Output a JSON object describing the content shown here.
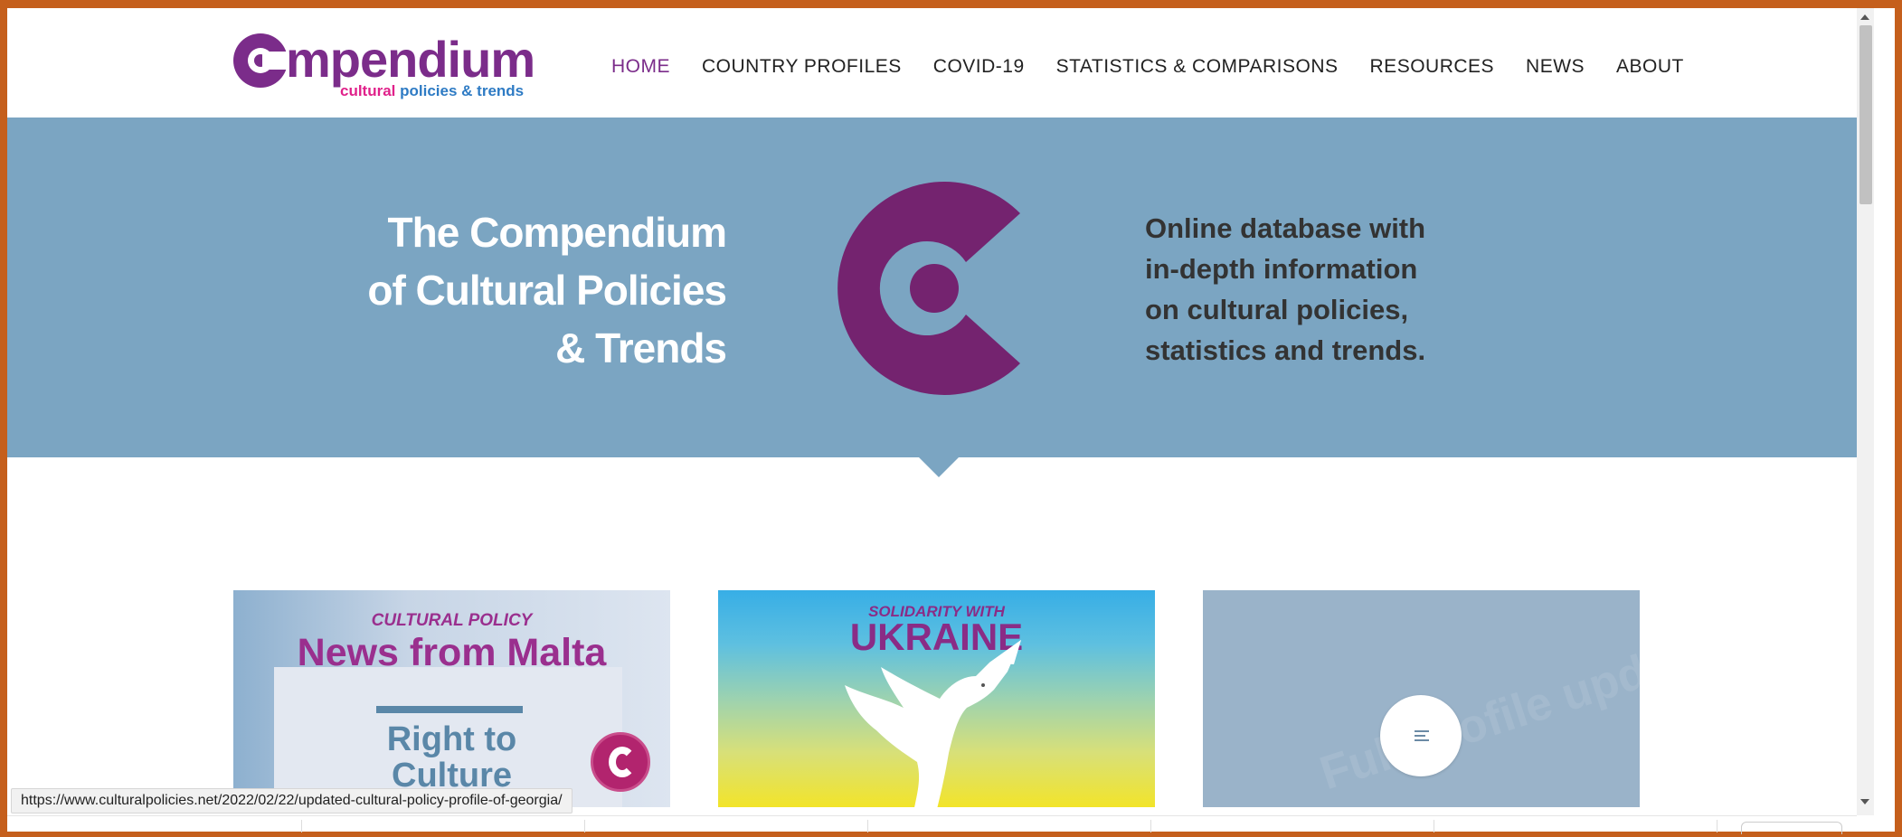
{
  "logo": {
    "wordmark": "mpendium",
    "tagline_part1": "cultural",
    "tagline_part2": "policies & trends"
  },
  "nav": {
    "items": [
      {
        "label": "HOME",
        "active": true
      },
      {
        "label": "COUNTRY PROFILES"
      },
      {
        "label": "COVID-19"
      },
      {
        "label": "STATISTICS & COMPARISONS"
      },
      {
        "label": "RESOURCES"
      },
      {
        "label": "NEWS"
      },
      {
        "label": "ABOUT"
      }
    ]
  },
  "hero": {
    "title_line1": "The Compendium",
    "title_line2": "of Cultural Policies",
    "title_line3": "& Trends",
    "text_line1": "Online database with",
    "text_line2": "in-depth information",
    "text_line3": "on cultural policies,",
    "text_line4": "statistics and trends."
  },
  "cards": [
    {
      "kicker": "CULTURAL POLICY",
      "headline": "News from Malta",
      "sub_line1": "Right to",
      "sub_line2": "Culture"
    },
    {
      "kicker": "SOLIDARITY WITH",
      "headline": "UKRAINE"
    },
    {
      "ghost_text": "Full profile updated"
    }
  ],
  "status_bar": {
    "url": "https://www.culturalpolicies.net/2022/02/22/updated-cultural-policy-profile-of-georgia/"
  },
  "colors": {
    "brand_purple": "#7b2c8a",
    "brand_pink": "#e0218a",
    "brand_blue": "#2e7bc4",
    "hero_bg": "#7ba5c2",
    "frame": "#c55f1c"
  }
}
